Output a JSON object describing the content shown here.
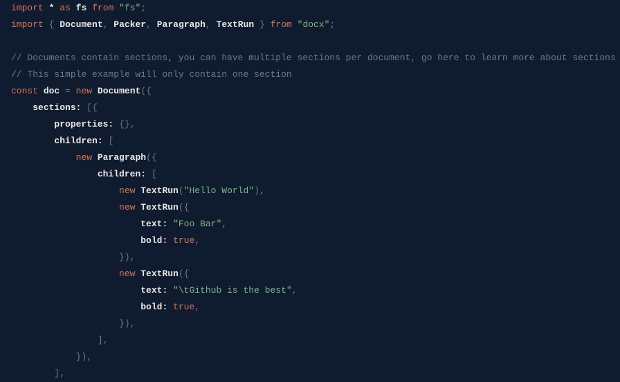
{
  "code": {
    "line1": {
      "import": "import",
      "star": "*",
      "as": "as",
      "alias": "fs",
      "from": "from",
      "module": "\"fs\"",
      "semi": ";"
    },
    "line2": {
      "import": "import",
      "lbrace": "{",
      "id1": "Document",
      "c1": ",",
      "id2": "Packer",
      "c2": ",",
      "id3": "Paragraph",
      "c3": ",",
      "id4": "TextRun",
      "rbrace": "}",
      "from": "from",
      "module": "\"docx\"",
      "semi": ";"
    },
    "comment1": "// Documents contain sections, you can have multiple sections per document, go here to learn more about sections",
    "comment2": "// This simple example will only contain one section",
    "line5": {
      "const": "const",
      "name": "doc",
      "eq": "=",
      "new": "new",
      "type": "Document",
      "lparen": "(",
      "lbrace": "{"
    },
    "line6": {
      "prop": "sections:",
      "lbracket": "[",
      "lbrace": "{"
    },
    "line7": {
      "prop": "properties:",
      "lbrace": "{",
      "rbrace": "}",
      "comma": ","
    },
    "line8": {
      "prop": "children:",
      "lbracket": "["
    },
    "line9": {
      "new": "new",
      "type": "Paragraph",
      "lparen": "(",
      "lbrace": "{"
    },
    "line10": {
      "prop": "children:",
      "lbracket": "["
    },
    "line11": {
      "new": "new",
      "type": "TextRun",
      "lparen": "(",
      "str": "\"Hello World\"",
      "rparen": ")",
      "comma": ","
    },
    "line12": {
      "new": "new",
      "type": "TextRun",
      "lparen": "(",
      "lbrace": "{"
    },
    "line13": {
      "prop": "text:",
      "str": "\"Foo Bar\"",
      "comma": ","
    },
    "line14": {
      "prop": "bold:",
      "val": "true",
      "comma": ","
    },
    "line15": {
      "rbrace": "}",
      "rparen": ")",
      "comma": ","
    },
    "line16": {
      "new": "new",
      "type": "TextRun",
      "lparen": "(",
      "lbrace": "{"
    },
    "line17": {
      "prop": "text:",
      "str": "\"\\tGithub is the best\"",
      "comma": ","
    },
    "line18": {
      "prop": "bold:",
      "val": "true",
      "comma": ","
    },
    "line19": {
      "rbrace": "}",
      "rparen": ")",
      "comma": ","
    },
    "line20": {
      "rbracket": "]",
      "comma": ","
    },
    "line21": {
      "rbrace": "}",
      "rparen": ")",
      "comma": ","
    },
    "line22": {
      "rbracket": "]",
      "comma": ","
    }
  }
}
